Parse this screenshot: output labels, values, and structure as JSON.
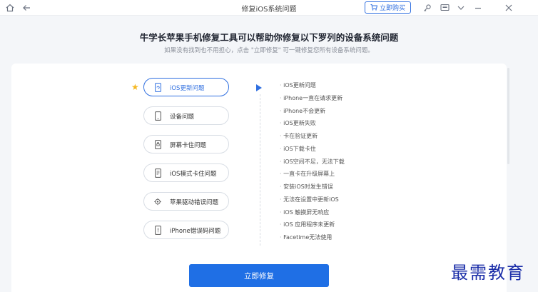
{
  "window": {
    "title": "修复iOS系统问题",
    "buy_label": "立即购买"
  },
  "header": {
    "headline": "牛学长苹果手机修复工具可以帮助你修复以下罗列的设备系统问题",
    "subline": "如果没有找到也不用担心，点击 \"立即修复\" 可一键修复您所有设备系统问题。"
  },
  "categories": [
    {
      "label": "iOS更新问题",
      "icon": "phone-refresh-icon",
      "active": true
    },
    {
      "label": "设备问题",
      "icon": "phone-icon",
      "active": false
    },
    {
      "label": "屏幕卡住问题",
      "icon": "phone-lock-icon",
      "active": false
    },
    {
      "label": "iOS模式卡住问题",
      "icon": "phone-mode-icon",
      "active": false
    },
    {
      "label": "苹果驱动错误问题",
      "icon": "gear-icon",
      "active": false
    },
    {
      "label": "iPhone错误码问题",
      "icon": "phone-error-icon",
      "active": false
    }
  ],
  "issues": [
    "iOS更新问题",
    "iPhone一直在请求更新",
    "iPhone不会更新",
    "iOS更新失败",
    "卡在验证更新",
    "iOS下载卡住",
    "iOS空间不足，无法下载",
    "一直卡在升级屏幕上",
    "安装iOS时发生错误",
    "无法在设置中更新iOS",
    "iOS 触摸屏无响应",
    "iOS 应用程序未更新",
    "Facetime无法使用"
  ],
  "fix_button": "立即修复",
  "watermark": "最需教育",
  "colors": {
    "accent": "#1f6fe5",
    "star": "#f5b823",
    "watermark": "#1a2da8"
  }
}
